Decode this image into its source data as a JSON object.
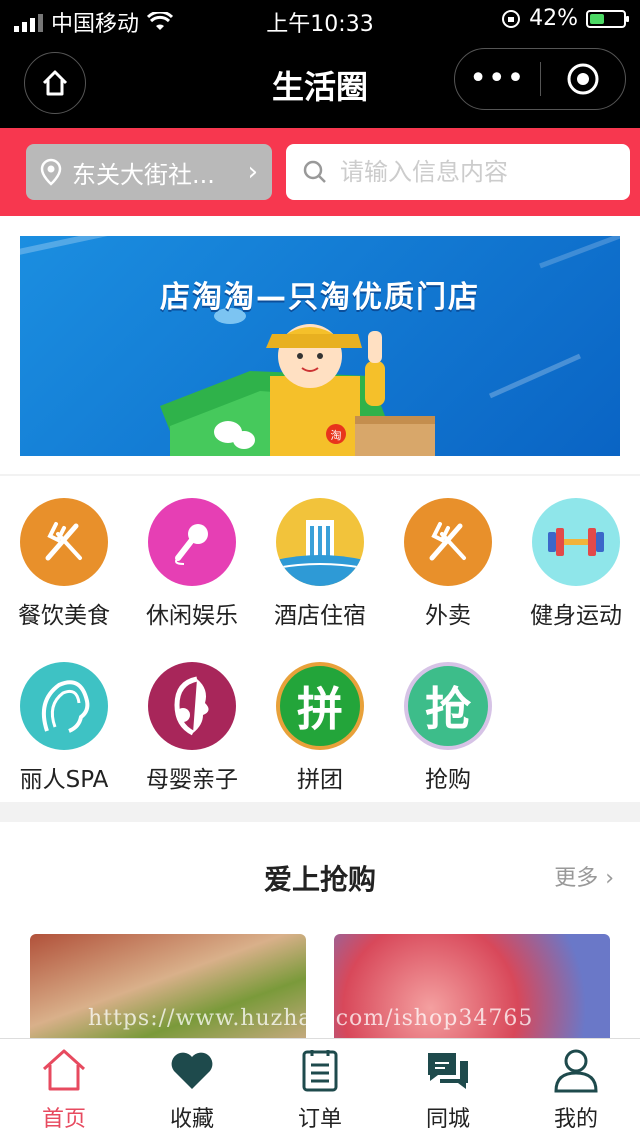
{
  "status_bar": {
    "carrier": "中国移动",
    "time": "上午10:33",
    "battery": "42%"
  },
  "nav": {
    "title": "生活圈",
    "more_label": "•••"
  },
  "search": {
    "location": "东关大街社...",
    "placeholder": "请输入信息内容"
  },
  "banner": {
    "title": "店淘淘—只淘优质门店",
    "badge": "淘"
  },
  "categories": [
    {
      "label": "餐饮美食",
      "color": "#e8902b",
      "icon": "fork-knife-icon"
    },
    {
      "label": "休闲娱乐",
      "color": "#e63fb4",
      "icon": "microphone-icon"
    },
    {
      "label": "酒店住宿",
      "color": "#f2c33b",
      "icon": "hotel-icon"
    },
    {
      "label": "外卖",
      "color": "#e8902b",
      "icon": "fork-knife-icon"
    },
    {
      "label": "健身运动",
      "color": "#8fe6ea",
      "icon": "dumbbell-icon"
    },
    {
      "label": "丽人SPA",
      "color": "#3ec2c4",
      "icon": "face-icon"
    },
    {
      "label": "母婴亲子",
      "color": "#a8265a",
      "icon": "mother-icon"
    },
    {
      "label": "拼团",
      "color": "#23a53a",
      "icon": "group-buy-icon",
      "glyph": "拼"
    },
    {
      "label": "抢购",
      "color": "#3dbd8a",
      "icon": "flash-sale-icon",
      "glyph": "抢"
    }
  ],
  "section": {
    "title": "爱上抢购",
    "more": "更多"
  },
  "watermark": "https://www.huzhan.com/ishop34765",
  "tabbar": [
    {
      "label": "首页",
      "icon": "home-icon",
      "active": true
    },
    {
      "label": "收藏",
      "icon": "heart-icon"
    },
    {
      "label": "订单",
      "icon": "order-icon"
    },
    {
      "label": "同城",
      "icon": "chat-icon"
    },
    {
      "label": "我的",
      "icon": "user-icon"
    }
  ],
  "colors": {
    "accent": "#f7374f",
    "active_tab": "#e74a5f"
  }
}
